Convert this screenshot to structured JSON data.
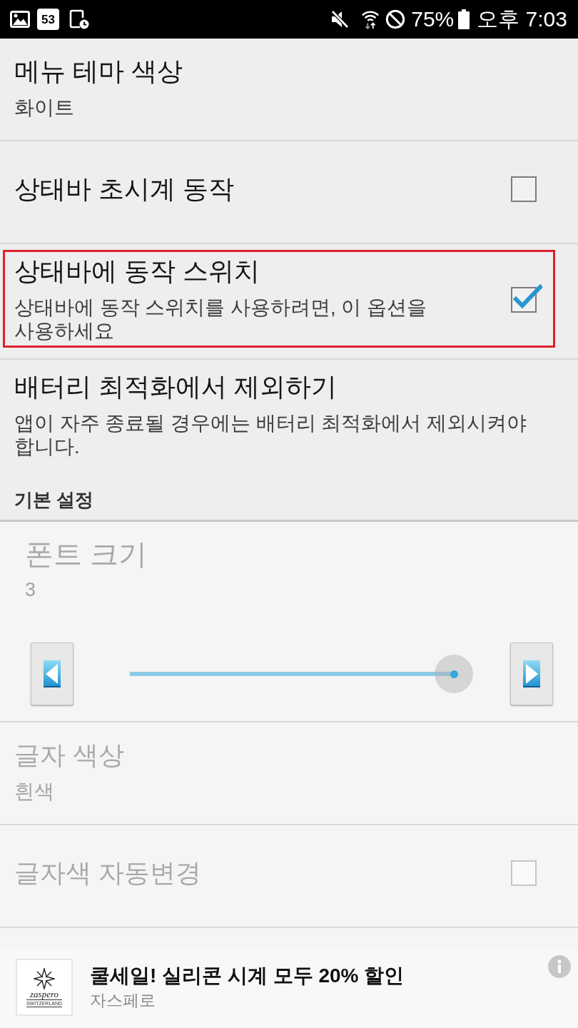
{
  "status_bar": {
    "notification_count": "53",
    "battery": "75%",
    "time": "오후 7:03"
  },
  "preferences": [
    {
      "kind": "text",
      "title": "메뉴 테마 색상",
      "summary": "화이트",
      "highlighted": false,
      "disabled": false
    },
    {
      "kind": "checkbox",
      "title": "상태바 초시계 동작",
      "checked": false,
      "highlighted": false,
      "disabled": false
    },
    {
      "kind": "checkbox",
      "title": "상태바에 동작 스위치",
      "summary": "상태바에 동작 스위치를 사용하려면, 이 옵션을 사용하세요",
      "checked": true,
      "highlighted": true,
      "disabled": false
    },
    {
      "kind": "text",
      "title": "배터리 최적화에서 제외하기",
      "summary": "앱이 자주 종료될 경우에는 배터리 최적화에서 제외시켜야 합니다.",
      "highlighted": false,
      "disabled": false
    }
  ],
  "section": {
    "title": "기본 설정",
    "items": [
      {
        "kind": "slider",
        "title": "폰트 크기",
        "summary": "3",
        "level": 1,
        "highlighted": false,
        "disabled": true
      },
      {
        "kind": "text",
        "title": "글자 색상",
        "summary": "흰색",
        "highlighted": false,
        "disabled": true
      },
      {
        "kind": "checkbox",
        "title": "글자색 자동변경",
        "checked": false,
        "highlighted": false,
        "disabled": true
      }
    ]
  },
  "ad": {
    "title": "쿨세일! 실리콘 시계 모두 20% 할인",
    "advertiser": "자스페로",
    "logo": {
      "wordmark": "zaspero",
      "tagline": "SWITZERLAND"
    }
  }
}
